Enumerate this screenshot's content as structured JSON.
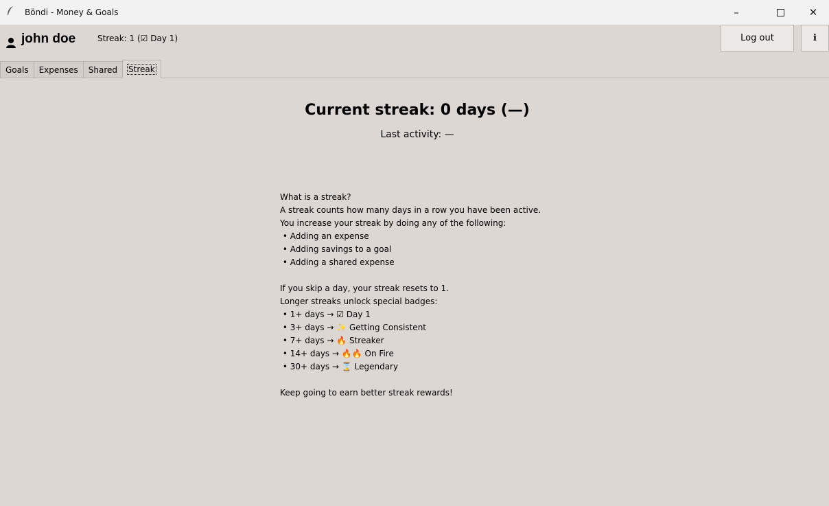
{
  "window": {
    "title": "Böndi - Money & Goals",
    "minimize_glyph": "–",
    "close_glyph": "✕"
  },
  "header": {
    "username": "john doe",
    "streak_label": "Streak: 1 (☑ Day 1)",
    "logout_label": "Log out",
    "info_label": "i"
  },
  "tabs": [
    {
      "label": "Goals"
    },
    {
      "label": "Expenses"
    },
    {
      "label": "Shared"
    },
    {
      "label": "Streak",
      "active": true
    }
  ],
  "streak": {
    "heading": "Current streak: 0 days  (—)",
    "last_activity": "Last activity: —",
    "info_lines": [
      "What is a streak?",
      "A streak counts how many days in a row you have been active.",
      "You increase your streak by doing any of the following:",
      " • Adding an expense",
      " • Adding savings to a goal",
      " • Adding a shared expense",
      "",
      "If you skip a day, your streak resets to 1.",
      "Longer streaks unlock special badges:",
      " • 1+ days → ☑ Day 1",
      " • 3+ days → ✨ Getting Consistent",
      " • 7+ days → 🔥 Streaker",
      " • 14+ days → 🔥🔥 On Fire",
      " • 30+ days → ⌛ Legendary",
      "",
      "Keep going to earn better streak rewards!"
    ]
  },
  "colors": {
    "background": "#dcd7d2",
    "titlebar": "#f2f2f2"
  }
}
